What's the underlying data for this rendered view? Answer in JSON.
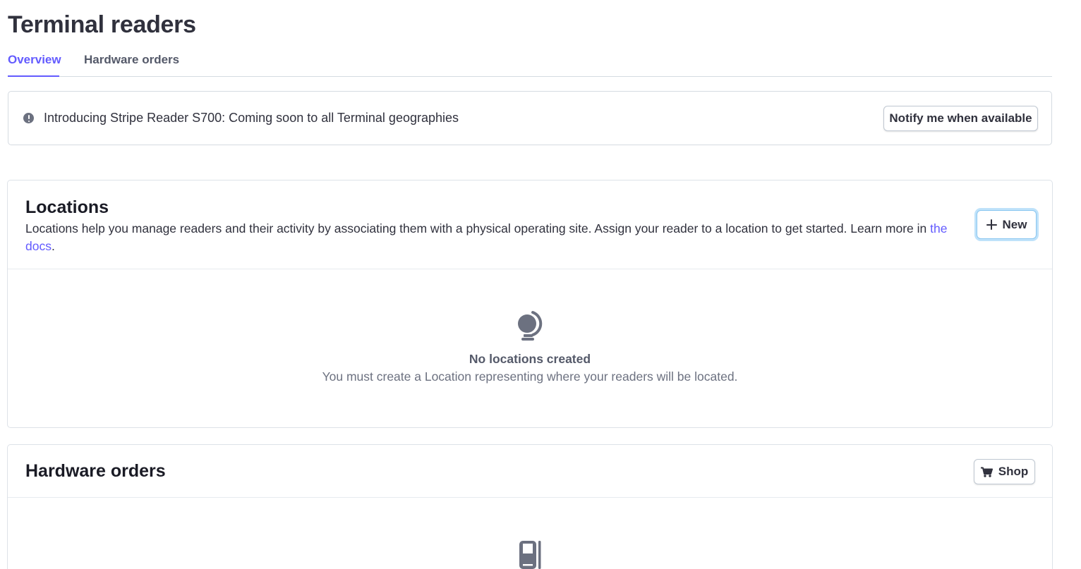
{
  "page": {
    "title": "Terminal readers"
  },
  "tabs": [
    {
      "label": "Overview",
      "active": true
    },
    {
      "label": "Hardware orders",
      "active": false
    }
  ],
  "banner": {
    "icon": "alert-circle-icon",
    "text": "Introducing Stripe Reader S700: Coming soon to all Terminal geographies",
    "button_label": "Notify me when available"
  },
  "locations": {
    "title": "Locations",
    "description": "Locations help you manage readers and their activity by associating them with a physical operating site. Assign your reader to a location to get started. Learn more in ",
    "link_text": "the docs",
    "description_end": ".",
    "new_button_label": "New",
    "empty_icon": "globe-icon",
    "empty_title": "No locations created",
    "empty_description": "You must create a Location representing where your readers will be located."
  },
  "hardware_orders": {
    "title": "Hardware orders",
    "shop_button_label": "Shop",
    "shop_icon": "cart-icon",
    "empty_icon": "card-reader-icon"
  },
  "colors": {
    "accent": "#635bff",
    "text": "#30313d",
    "muted": "#6c7180",
    "border": "#d5dbe1",
    "focus_ring": "#bfe2fa"
  }
}
